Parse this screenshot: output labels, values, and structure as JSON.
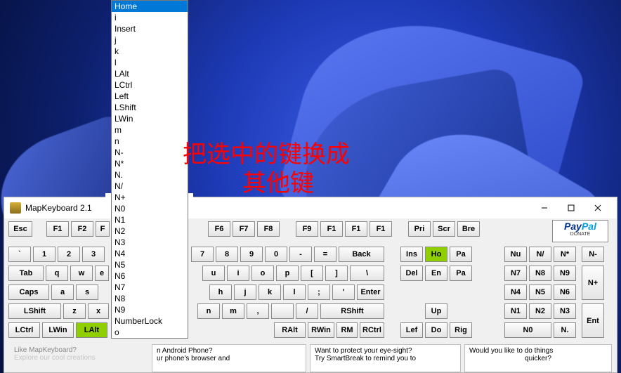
{
  "annotation": "把选中的键换成\n         其他键",
  "window": {
    "title": "MapKeyboard 2.1"
  },
  "dropdown": {
    "items": [
      "Home",
      "i",
      "Insert",
      "j",
      "k",
      "l",
      "LAlt",
      "LCtrl",
      "Left",
      "LShift",
      "LWin",
      "m",
      "n",
      "N-",
      "N*",
      "N.",
      "N/",
      "N+",
      "N0",
      "N1",
      "N2",
      "N3",
      "N4",
      "N5",
      "N6",
      "N7",
      "N8",
      "N9",
      "NumberLock",
      "o"
    ],
    "selected": "Home"
  },
  "fnrow": {
    "esc": "Esc",
    "f1": "F1",
    "f2": "F2",
    "f3": "F",
    "f6": "F6",
    "f7": "F7",
    "f8": "F8",
    "f9": "F9",
    "f10": "F1",
    "f11": "F1",
    "f12": "F1",
    "pri": "Pri",
    "scr": "Scr",
    "bre": "Bre"
  },
  "r1": {
    "tick": "`",
    "k1": "1",
    "k2": "2",
    "k3": "3",
    "k7": "7",
    "k8": "8",
    "k9": "9",
    "k0": "0",
    "kminus": "-",
    "keq": "=",
    "back": "Back",
    "ins": "Ins",
    "ho": "Ho",
    "pa": "Pa",
    "nu": "Nu",
    "nslash": "N/",
    "nstar": "N*",
    "nminus": "N-"
  },
  "r2": {
    "tab": "Tab",
    "q": "q",
    "w": "w",
    "e": "e",
    "u": "u",
    "i": "i",
    "o": "o",
    "p": "p",
    "lb": "[",
    "rb": "]",
    "bsl": "\\",
    "del": "Del",
    "en": "En",
    "pa": "Pa",
    "n7": "N7",
    "n8": "N8",
    "n9": "N9",
    "nplus": "N+"
  },
  "r3": {
    "caps": "Caps",
    "a": "a",
    "s": "s",
    "h": "h",
    "j": "j",
    "k": "k",
    "l": "l",
    "semi": ";",
    "apos": "'",
    "enter": "Enter",
    "n4": "N4",
    "n5": "N5",
    "n6": "N6"
  },
  "r4": {
    "lshift": "LShift",
    "z": "z",
    "x": "x",
    "n": "n",
    "m": "m",
    "comma": ",",
    ".": ".",
    "slash": "/",
    "rshift": "RShift",
    "up": "Up",
    "n1": "N1",
    "n2": "N2",
    "n3": "N3",
    "ent": "Ent"
  },
  "r5": {
    "lctrl": "LCtrl",
    "lwin": "LWin",
    "lalt": "LAlt",
    "ralt": "RAlt",
    "rwin": "RWin",
    "rm": "RM",
    "rctrl": "RCtrl",
    "lef": "Lef",
    "do": "Do",
    "rig": "Rig",
    "n0": "N0",
    "ndot": "N."
  },
  "paypal": {
    "brand_a": "Pay",
    "brand_b": "Pal",
    "donate": "DONATE"
  },
  "promos": {
    "p1a": "Like MapKeyboard?",
    "p1b": "Explore our cool creations",
    "p2a": "n Android Phone?",
    "p2b": "ur phone's browser and",
    "p3a": "Want to protect your eye-sight?",
    "p3b": "Try SmartBreak to remind you to",
    "p4a": "Would you like to do things",
    "p4b": "quicker?"
  }
}
